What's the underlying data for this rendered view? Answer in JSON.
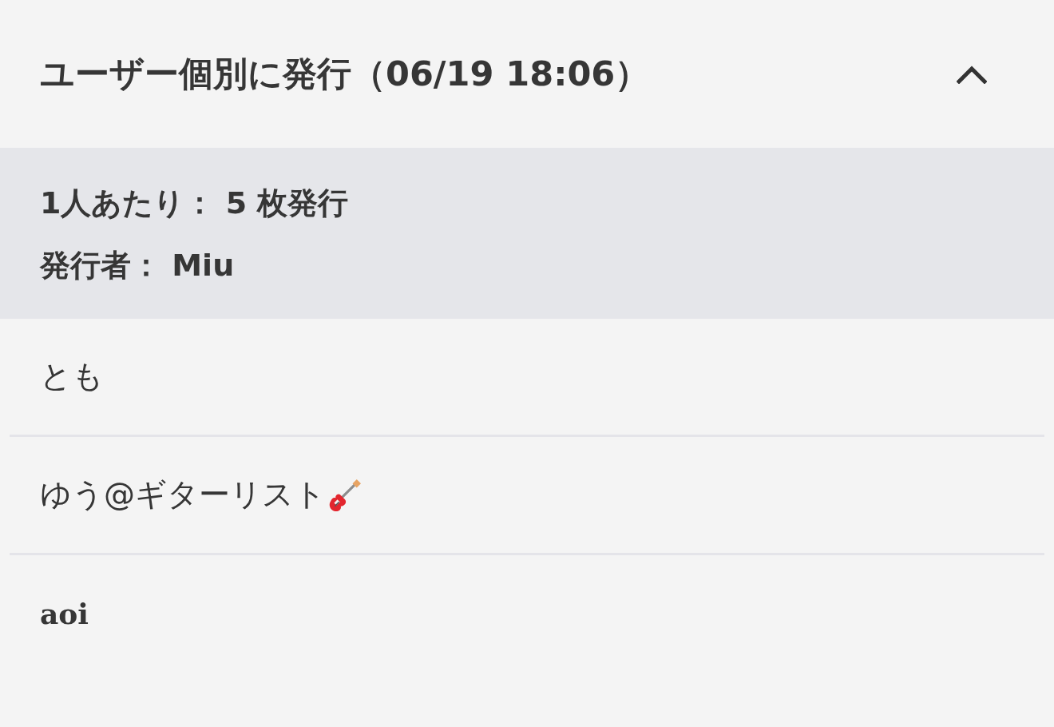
{
  "section": {
    "title": "ユーザー個別に発行（06/19 18:06）",
    "expanded": true,
    "details": [
      {
        "label": "1人あたり：",
        "value": "5 枚発行"
      },
      {
        "label": "発行者：",
        "value": "Miu"
      }
    ],
    "recipients": [
      {
        "name": "とも",
        "kind": "plain",
        "trailing_icon": false
      },
      {
        "name": "ゆう@ギターリスト",
        "kind": "plain",
        "trailing_icon": true
      },
      {
        "name": "aoi",
        "kind": "fancy",
        "trailing_icon": false
      }
    ]
  }
}
